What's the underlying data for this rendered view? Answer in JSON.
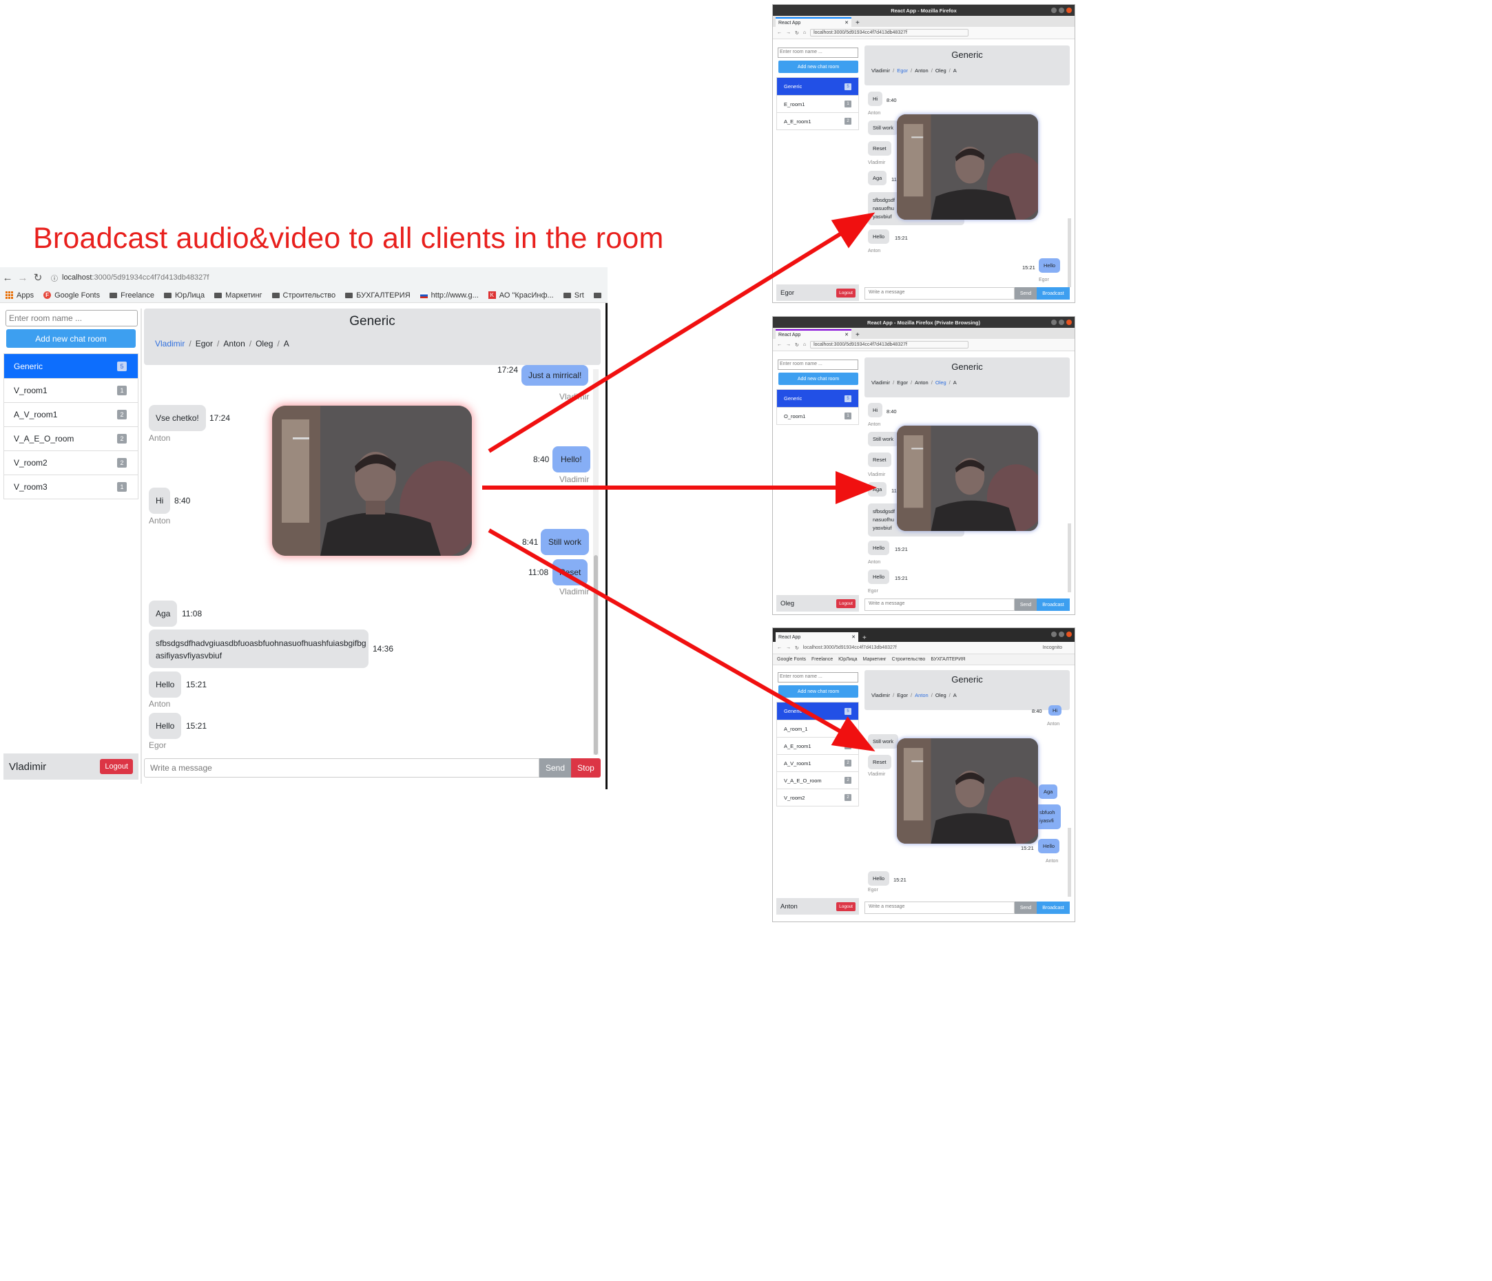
{
  "headline": "Broadcast audio&video to all  clients in the room",
  "main": {
    "url_host": "localhost",
    "url_path": ":3000/5d91934cc4f7d413db48327f",
    "bookmarks": [
      "Apps",
      "Google Fonts",
      "Freelance",
      "ЮрЛица",
      "Маркетинг",
      "Строительство",
      "БУХГАЛТЕРИЯ",
      "http://www.g...",
      "АО \"КрасИнф...",
      "Srt"
    ],
    "room_input_placeholder": "Enter room name ...",
    "add_room_label": "Add new chat room",
    "rooms": [
      {
        "name": "Generic",
        "count": "5"
      },
      {
        "name": "V_room1",
        "count": "1"
      },
      {
        "name": "A_V_room1",
        "count": "2"
      },
      {
        "name": "V_A_E_O_room",
        "count": "2"
      },
      {
        "name": "V_room2",
        "count": "2"
      },
      {
        "name": "V_room3",
        "count": "1"
      }
    ],
    "user": "Vladimir",
    "logout_label": "Logout",
    "room_title": "Generic",
    "participants": [
      "Vladimir",
      "Egor",
      "Anton",
      "Oleg",
      "A"
    ],
    "messages": {
      "m1": {
        "text": "Just a mirrical!",
        "time": "17:24",
        "author": "Vladimir"
      },
      "m2": {
        "text": "Vse chetko!",
        "time": "17:24",
        "author": "Anton"
      },
      "m3": {
        "text": "Hello!",
        "time": "8:40",
        "author": "Vladimir"
      },
      "m4": {
        "text": "Hi",
        "time": "8:40",
        "author": "Anton"
      },
      "m5": {
        "text": "Still work",
        "time": "8:41"
      },
      "m6": {
        "text": "Reset",
        "time": "11:08",
        "author": "Vladimir"
      },
      "m7": {
        "text": "Aga",
        "time": "11:08"
      },
      "m8": {
        "text_line1": "sfbsdgsdfhadvgiuasdbfuoasbfuohnasuofhuashfuiasbgifbg",
        "text_line2": "asifiyasvfiyasvbiuf",
        "time": "14:36"
      },
      "m9": {
        "text": "Hello",
        "time": "15:21",
        "author": "Anton"
      },
      "m10": {
        "text": "Hello",
        "time": "15:21",
        "author": "Egor"
      }
    },
    "composer_placeholder": "Write a message",
    "send_label": "Send",
    "stop_label": "Stop"
  },
  "win1": {
    "title": "React App - Mozilla Firefox",
    "tab": "React App",
    "url": "localhost:3000/5d91934cc4f7d413db48327f",
    "room_input_placeholder": "Enter room name ...",
    "add_room_label": "Add new chat room",
    "rooms": [
      {
        "name": "Generic",
        "count": "5"
      },
      {
        "name": "E_room1",
        "count": "1"
      },
      {
        "name": "A_E_room1",
        "count": "2"
      }
    ],
    "room_title": "Generic",
    "participants": [
      "Vladimir",
      "Egor",
      "Anton",
      "Oleg",
      "A"
    ],
    "msgs": {
      "a": {
        "text": "Hi",
        "time": "8:40",
        "author": "Anton"
      },
      "b": {
        "text": "Still work"
      },
      "c": {
        "text": "Reset",
        "author": "Vladimir"
      },
      "d": {
        "text": "Aga",
        "time": "11"
      },
      "e": {
        "l1": "sfbsdgsdf",
        "l2": "nasuofhu",
        "l3": "yasvbiuf"
      },
      "f": {
        "text": "Hello",
        "time": "15:21",
        "author": "Anton"
      },
      "g": {
        "text": "Hello",
        "time": "15:21",
        "author": "Egor"
      }
    },
    "user": "Egor",
    "logout_label": "Logout",
    "composer_placeholder": "Write a message",
    "send_label": "Send",
    "broadcast_label": "Broadcast"
  },
  "win2": {
    "title": "React App - Mozilla Firefox (Private Browsing)",
    "tab": "React App",
    "url": "localhost:3000/5d91934cc4f7d413db48327f",
    "room_input_placeholder": "Enter room name ...",
    "add_room_label": "Add new chat room",
    "rooms": [
      {
        "name": "Generic",
        "count": "5"
      },
      {
        "name": "O_room1",
        "count": "1"
      }
    ],
    "room_title": "Generic",
    "participants": [
      "Vladimir",
      "Egor",
      "Anton",
      "Oleg",
      "A"
    ],
    "msgs": {
      "a": {
        "text": "Hi",
        "time": "8:40",
        "author": "Anton"
      },
      "b": {
        "text": "Still work"
      },
      "c": {
        "text": "Reset",
        "author": "Vladimir"
      },
      "d": {
        "text": "Aga",
        "time": "11"
      },
      "e": {
        "l1": "sfbsdgsdf",
        "l2": "nasuofhu",
        "l3": "yasvbiuf"
      },
      "f": {
        "text": "Hello",
        "time": "15:21",
        "author": "Anton"
      },
      "g": {
        "text": "Hello",
        "time": "15:21",
        "author": "Egor"
      }
    },
    "user": "Oleg",
    "logout_label": "Logout",
    "composer_placeholder": "Write a message",
    "send_label": "Send",
    "broadcast_label": "Broadcast"
  },
  "win3": {
    "tab": "React App",
    "url": "localhost:3000/5d91934cc4f7d413db48327f",
    "incognito": "Incognito",
    "bookmarks": [
      "Google Fonts",
      "Freelance",
      "ЮрЛица",
      "Маркетинг",
      "Строительство",
      "БУХГАЛТЕРИЯ"
    ],
    "room_input_placeholder": "Enter room name ...",
    "add_room_label": "Add new chat room",
    "rooms": [
      {
        "name": "Generic",
        "count": "5"
      },
      {
        "name": "A_room_1",
        "count": "1"
      },
      {
        "name": "A_E_room1",
        "count": "2"
      },
      {
        "name": "A_V_room1",
        "count": "2"
      },
      {
        "name": "V_A_E_O_room",
        "count": "2"
      },
      {
        "name": "V_room2",
        "count": "2"
      }
    ],
    "room_title": "Generic",
    "participants": [
      "Vladimir",
      "Egor",
      "Anton",
      "Oleg",
      "A"
    ],
    "msgs": {
      "a": {
        "text": "Hi",
        "time": "8:40",
        "author": "Anton"
      },
      "b": {
        "text": "Still work"
      },
      "c": {
        "text": "Reset",
        "author": "Vladimir"
      },
      "d": {
        "text": "Aga"
      },
      "e": {
        "l1": "sbfuoh",
        "l2": "iyasvfi"
      },
      "f": {
        "text": "Hello",
        "time": "15:21",
        "author": "Anton"
      },
      "g": {
        "text": "Hello",
        "time": "15:21",
        "author": "Egor"
      }
    },
    "user": "Anton",
    "logout_label": "Logout",
    "composer_placeholder": "Write a message",
    "send_label": "Send",
    "broadcast_label": "Broadcast"
  },
  "colors": {
    "arrow": "#f01010",
    "primary": "#0d6efd",
    "danger": "#dc3545",
    "broadcast": "#3d9ff0"
  }
}
